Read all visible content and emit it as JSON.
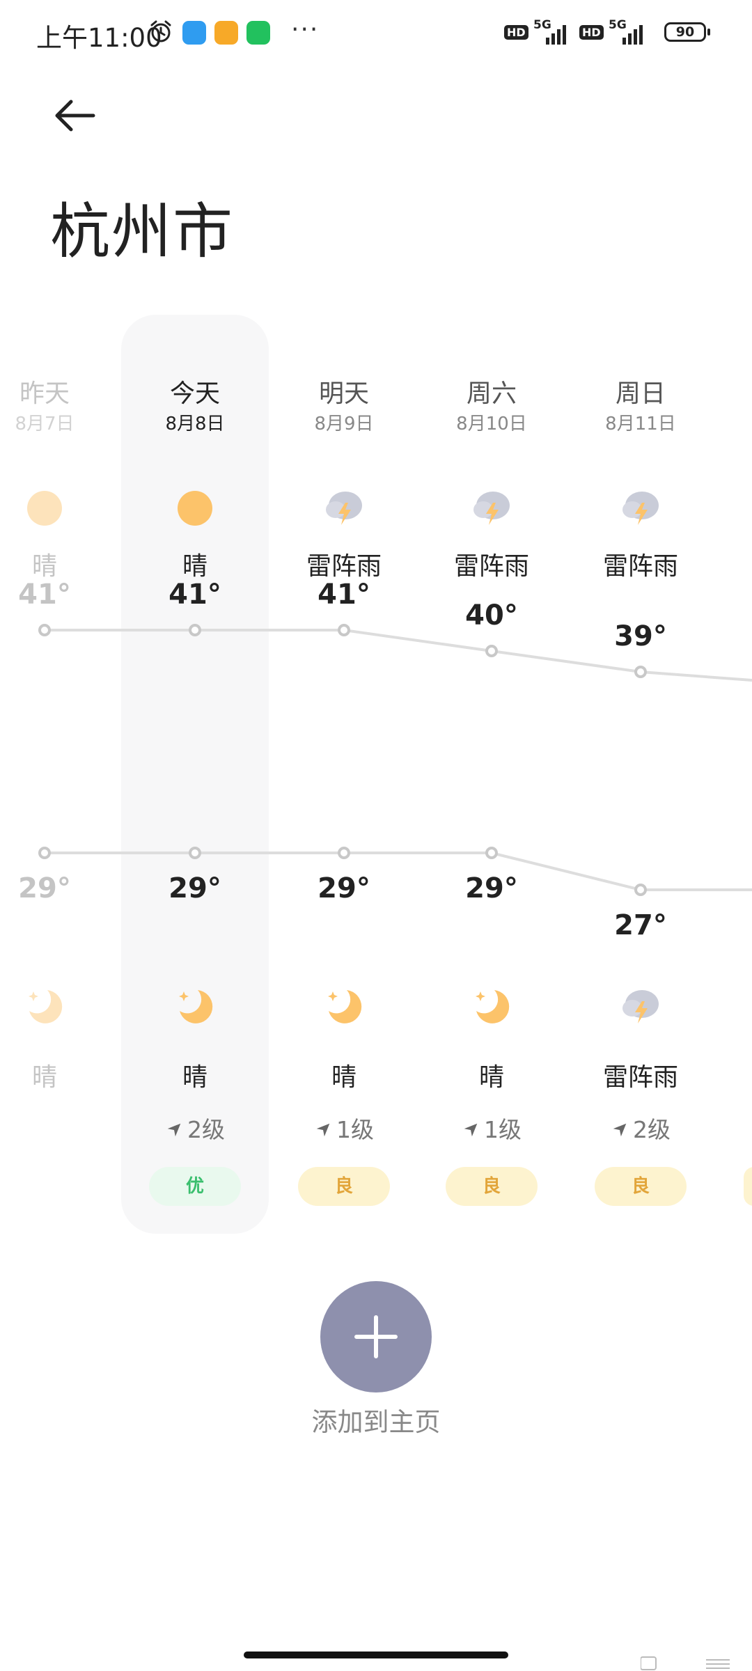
{
  "status_bar": {
    "time": "上午11:00",
    "network_1": "5G",
    "network_2": "5G",
    "hd_1": "HD",
    "hd_2": "HD",
    "battery": "90",
    "more": "···",
    "app_icon_colors": [
      "#2f9cf0",
      "#f7a928",
      "#22c15e"
    ]
  },
  "header": {
    "back_icon": "arrow-left-icon",
    "city": "杭州市"
  },
  "days": [
    {
      "name": "昨天",
      "date": "8月7日",
      "day_icon": "sun-icon",
      "day_condition": "晴",
      "high": "41°",
      "high_value": 41,
      "low": "29°",
      "low_value": 29,
      "night_icon": "moon-icon",
      "night_condition": "晴",
      "wind": "",
      "aqi": "",
      "faded": true
    },
    {
      "name": "今天",
      "date": "8月8日",
      "day_icon": "sun-icon",
      "day_condition": "晴",
      "high": "41°",
      "high_value": 41,
      "low": "29°",
      "low_value": 29,
      "night_icon": "moon-icon",
      "night_condition": "晴",
      "wind": "2级",
      "aqi": "优",
      "aqi_level": "good",
      "today": true
    },
    {
      "name": "明天",
      "date": "8月9日",
      "day_icon": "thunderstorm-icon",
      "day_condition": "雷阵雨",
      "high": "41°",
      "high_value": 41,
      "low": "29°",
      "low_value": 29,
      "night_icon": "moon-icon",
      "night_condition": "晴",
      "wind": "1级",
      "aqi": "良",
      "aqi_level": "moderate"
    },
    {
      "name": "周六",
      "date": "8月10日",
      "day_icon": "thunderstorm-icon",
      "day_condition": "雷阵雨",
      "high": "40°",
      "high_value": 40,
      "low": "29°",
      "low_value": 29,
      "night_icon": "moon-icon",
      "night_condition": "晴",
      "wind": "1级",
      "aqi": "良",
      "aqi_level": "moderate"
    },
    {
      "name": "周日",
      "date": "8月11日",
      "day_icon": "thunderstorm-icon",
      "day_condition": "雷阵雨",
      "high": "39°",
      "high_value": 39,
      "low": "27°",
      "low_value": 27,
      "night_icon": "thunderstorm-icon",
      "night_condition": "雷阵雨",
      "wind": "2级",
      "aqi": "良",
      "aqi_level": "moderate"
    }
  ],
  "colors": {
    "sun": "#fcc36a",
    "aqi_good_bg": "#e9f9ee",
    "aqi_good_text": "#3bbf6e",
    "aqi_moderate_bg": "#fdf3cf",
    "aqi_moderate_text": "#e2a53a",
    "line": "#dddddd",
    "add_button": "#8e90ad"
  },
  "actions": {
    "add_icon": "plus-icon",
    "add_label": "添加到主页"
  }
}
